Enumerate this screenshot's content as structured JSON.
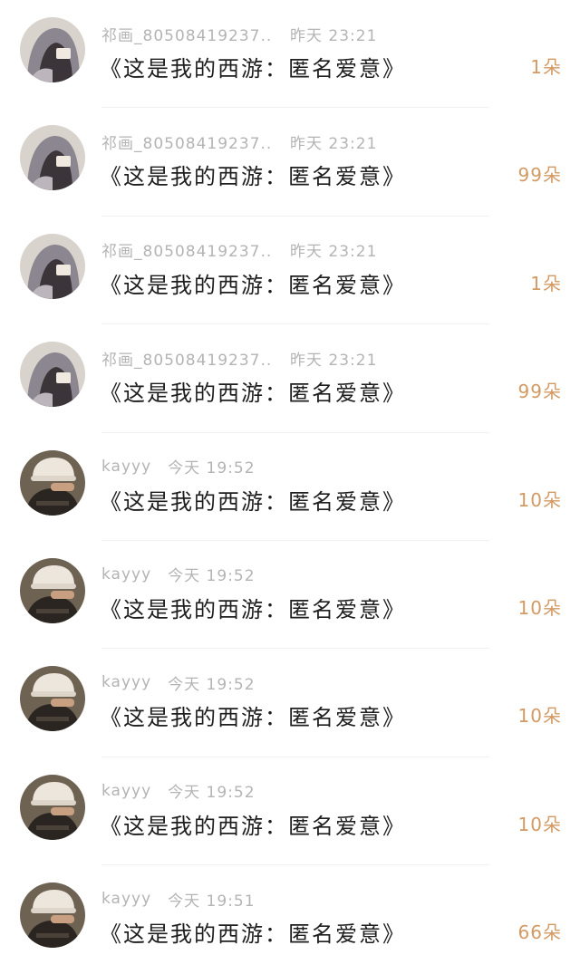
{
  "gifts": [
    {
      "avatar_icon": "user-avatar-hooded-icon",
      "username": "祁画_80508419237...",
      "time": "昨天 23:21",
      "title": "《这是我的西游：匿名爱意》",
      "count": "1朵"
    },
    {
      "avatar_icon": "user-avatar-hooded-icon",
      "username": "祁画_80508419237...",
      "time": "昨天 23:21",
      "title": "《这是我的西游：匿名爱意》",
      "count": "99朵"
    },
    {
      "avatar_icon": "user-avatar-hooded-icon",
      "username": "祁画_80508419237...",
      "time": "昨天 23:21",
      "title": "《这是我的西游：匿名爱意》",
      "count": "1朵"
    },
    {
      "avatar_icon": "user-avatar-hooded-icon",
      "username": "祁画_80508419237...",
      "time": "昨天 23:21",
      "title": "《这是我的西游：匿名爱意》",
      "count": "99朵"
    },
    {
      "avatar_icon": "user-avatar-cap-icon",
      "username": "kayyy",
      "time": "今天 19:52",
      "title": "《这是我的西游：匿名爱意》",
      "count": "10朵"
    },
    {
      "avatar_icon": "user-avatar-cap-icon",
      "username": "kayyy",
      "time": "今天 19:52",
      "title": "《这是我的西游：匿名爱意》",
      "count": "10朵"
    },
    {
      "avatar_icon": "user-avatar-cap-icon",
      "username": "kayyy",
      "time": "今天 19:52",
      "title": "《这是我的西游：匿名爱意》",
      "count": "10朵"
    },
    {
      "avatar_icon": "user-avatar-cap-icon",
      "username": "kayyy",
      "time": "今天 19:52",
      "title": "《这是我的西游：匿名爱意》",
      "count": "10朵"
    },
    {
      "avatar_icon": "user-avatar-cap-icon",
      "username": "kayyy",
      "time": "今天 19:51",
      "title": "《这是我的西游：匿名爱意》",
      "count": "66朵"
    }
  ],
  "colors": {
    "count_accent": "#d39a63",
    "meta_gray": "#b4b4b4",
    "title_text": "#1e1e1e"
  }
}
